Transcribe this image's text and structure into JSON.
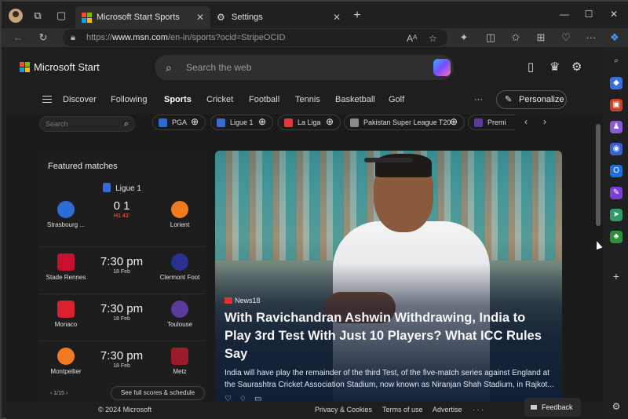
{
  "browser": {
    "tabs": [
      {
        "title": "Microsoft Start Sports",
        "active": true
      },
      {
        "title": "Settings",
        "active": false
      }
    ],
    "new_tab_icon": "+",
    "url": {
      "prefix": "https://",
      "host": "www.msn.com",
      "path": "/en-in/sports?ocid=StripeOCID"
    },
    "read_aloud_label": "Aᴬ"
  },
  "header": {
    "brand": "Microsoft Start",
    "search_placeholder": "Search the web"
  },
  "topnav": {
    "items": [
      "Discover",
      "Following",
      "Sports",
      "Cricket",
      "Football",
      "Tennis",
      "Basketball",
      "Golf"
    ],
    "active": "Sports",
    "more": "···",
    "personalize": "Personalize"
  },
  "chips": {
    "search_placeholder": "Search",
    "items": [
      "PGA",
      "Ligue 1",
      "La Liga",
      "Pakistan Super League T20",
      "Premi"
    ],
    "colors": [
      "#2a6bd6",
      "#3a6ad8",
      "#e03a3a",
      "#8a8a8a",
      "#5b3a9b"
    ]
  },
  "featured": {
    "title": "Featured matches",
    "league": "Ligue 1",
    "matches": [
      {
        "home": "Strasbourg ...",
        "away": "Lorient",
        "center": "0  1",
        "sub": "H1 43'",
        "live": true
      },
      {
        "home": "Stade Rennes",
        "away": "Clermont Foot",
        "center": "7:30 pm",
        "sub": "18 Feb",
        "live": false
      },
      {
        "home": "Monaco",
        "away": "Toulouse",
        "center": "7:30 pm",
        "sub": "18 Feb",
        "live": false
      },
      {
        "home": "Montpellier",
        "away": "Metz",
        "center": "7:30 pm",
        "sub": "18 Feb",
        "live": false
      }
    ],
    "crest_colors": [
      [
        "#2d6bd9",
        "#f27a1a"
      ],
      [
        "#c8102e",
        "#2b2f8f"
      ],
      [
        "#d8202e",
        "#5a3b9b"
      ],
      [
        "#f47a20",
        "#9c1b2a"
      ]
    ],
    "pager": "1/15",
    "see_all": "See full scores & schedule"
  },
  "hero": {
    "source": "News18",
    "title": "With Ravichandran Ashwin Withdrawing, India to Play 3rd Test With Just 10 Players? What ICC Rules Say",
    "description": "India will have play the remainder of the third Test, of the five-match series against England at the Saurashtra Cricket Association Stadium, now known as Niranjan Shah Stadium, in Rajkot..."
  },
  "footer": {
    "copyright": "© 2024 Microsoft",
    "links": [
      "Privacy & Cookies",
      "Terms of use",
      "Advertise"
    ],
    "more": "· · ·",
    "feedback": "Feedback"
  }
}
